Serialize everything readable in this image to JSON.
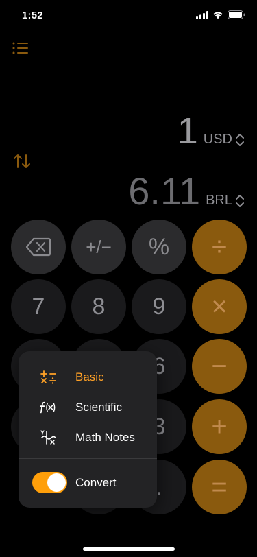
{
  "status_bar": {
    "time": "1:52"
  },
  "display": {
    "input_value": "1",
    "input_currency": "USD",
    "output_value": "6.11",
    "output_currency": "BRL"
  },
  "keypad": {
    "backspace": "",
    "sign": "+/−",
    "percent": "%",
    "divide": "÷",
    "seven": "7",
    "eight": "8",
    "nine": "9",
    "multiply": "×",
    "six": "6",
    "minus": "−",
    "three": "3",
    "plus": "+",
    "decimal": ".",
    "equals": "="
  },
  "mode_menu": {
    "items": [
      {
        "label": "Basic",
        "icon": "basic-ops-icon",
        "selected": true
      },
      {
        "label": "Scientific",
        "icon": "function-icon",
        "selected": false
      },
      {
        "label": "Math Notes",
        "icon": "math-notes-icon",
        "selected": false
      }
    ],
    "convert_label": "Convert",
    "convert_enabled": true
  },
  "colors": {
    "accent": "#ff9f0a",
    "operator_key": "#8a5a0e",
    "background": "#000000"
  }
}
